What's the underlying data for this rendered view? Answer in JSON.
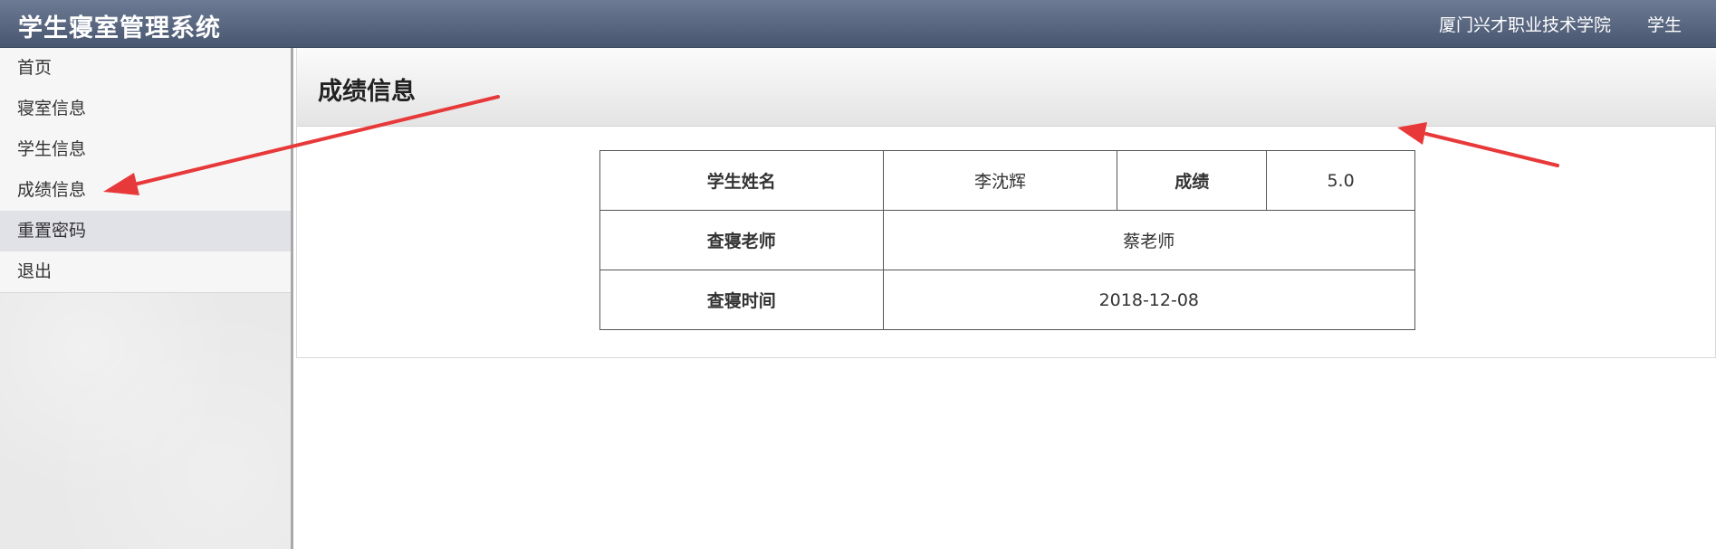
{
  "header": {
    "app_title": "学生寝室管理系统",
    "school_name": "厦门兴才职业技术学院",
    "user_role": "学生",
    "colors": {
      "bar_top": "#6c7a94",
      "bar_bottom": "#48566f"
    }
  },
  "sidebar": {
    "items": [
      {
        "label": "首页"
      },
      {
        "label": "寝室信息"
      },
      {
        "label": "学生信息"
      },
      {
        "label": "成绩信息"
      },
      {
        "label": "重置密码"
      },
      {
        "label": "退出"
      }
    ],
    "highlighted_item": "重置密码"
  },
  "main": {
    "title": "成绩信息",
    "table": {
      "student_name_label": "学生姓名",
      "student_name_value": "李沈辉",
      "score_label": "成绩",
      "score_value": "5.0",
      "inspector_label": "查寝老师",
      "inspector_value": "蔡老师",
      "time_label": "查寝时间",
      "time_value": "2018-12-08"
    }
  },
  "annotations": {
    "arrow_color": "#e8393a",
    "arrows": [
      "arrow pointing to 成绩信息 menu item",
      "arrow pointing to 成绩信息 panel header"
    ]
  }
}
